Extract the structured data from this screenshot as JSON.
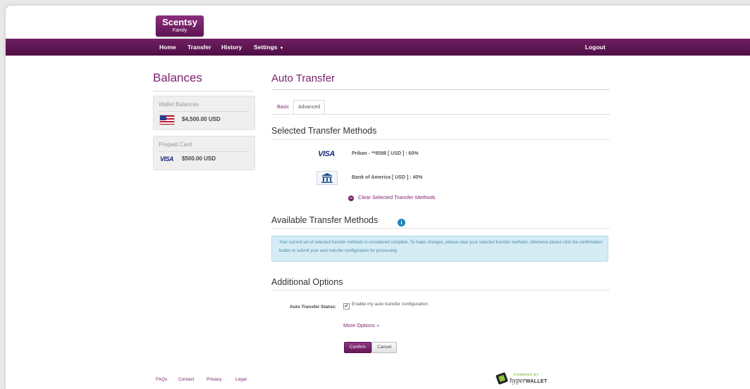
{
  "brand": {
    "name": "Scentsy",
    "subtitle": "Family"
  },
  "nav": {
    "items": [
      "Home",
      "Transfer",
      "History",
      "Settings"
    ],
    "settings_caret": "▼",
    "logout": "Logout"
  },
  "sidebar": {
    "heading": "Balances",
    "wallet": {
      "title": "Wallet Balances",
      "amount": "$4,500.00 USD",
      "icon": "us-flag-icon"
    },
    "prepaid": {
      "title": "Prepaid Card",
      "amount": "$500.00 USD",
      "icon_text": "VISA"
    }
  },
  "main": {
    "heading": "Auto Transfer",
    "tabs": [
      "Basic",
      "Advanced"
    ],
    "active_tab": "Advanced",
    "selected_heading": "Selected Transfer Methods",
    "methods": [
      {
        "icon": "visa-icon",
        "icon_text": "VISA",
        "name": "Priban - **8598",
        "currency": "[ USD ]",
        "percent": ": 60%"
      },
      {
        "icon": "bank-icon",
        "name": "Bank of America",
        "currency": "[ USD ]",
        "percent": ": 40%"
      }
    ],
    "clear_link": "Clear Selected Transfer Methods",
    "available_heading": "Available Transfer Methods",
    "info_text": "Your current set of selected transfer methods is considered complete. To make changes, please clear your selected transfer methods, otherwise please click the confirmation button to submit your auto transfer configuration for processing.",
    "additional_heading": "Additional Options",
    "status_label": "Auto Transfer Status:",
    "status_checkbox_label": "Enable my auto transfer configuration",
    "status_checked": true,
    "more_options": "More Options »",
    "confirm": "Confirm",
    "cancel": "Cancel"
  },
  "footer": {
    "links": [
      "FAQs",
      "Contact",
      "Privacy",
      "Legal"
    ],
    "powered_by": "POWERED BY",
    "provider_italic": "hyper",
    "provider_bold": "WALLET"
  },
  "colors": {
    "brand": "#6f1f63",
    "info_bg": "#d5ecf5",
    "info_badge": "#1f80c0"
  }
}
